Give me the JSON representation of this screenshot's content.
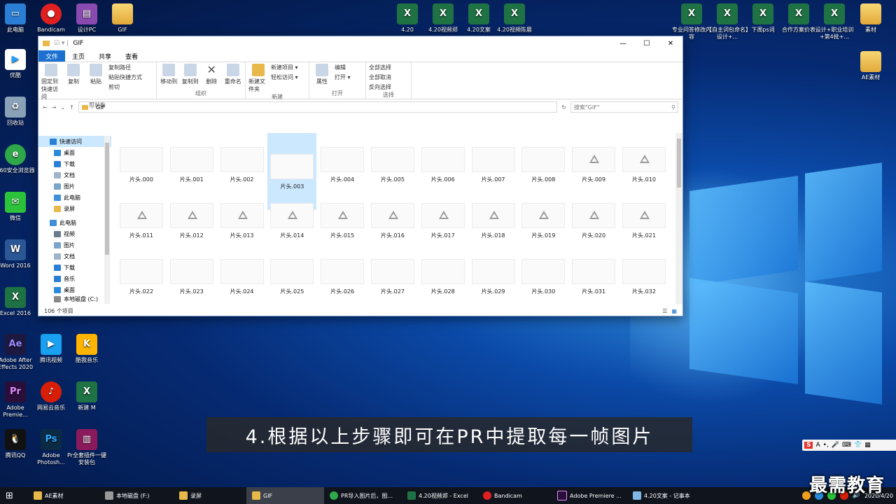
{
  "desktop_icons_left": [
    {
      "label": "此电脑",
      "icon": "computer-icon"
    },
    {
      "label": "Bandicam",
      "icon": "bandicam-icon"
    },
    {
      "label": "设计PC",
      "icon": "archive-icon"
    },
    {
      "label": "GIF",
      "icon": "folder-icon"
    },
    {
      "label": "优酷",
      "icon": "youku-icon"
    },
    {
      "label": "回收站",
      "icon": "recycle-bin-icon"
    },
    {
      "label": "360安全浏览器",
      "icon": "browser-icon"
    },
    {
      "label": "微信",
      "icon": "wechat-icon"
    },
    {
      "label": "Word 2016",
      "icon": "word-icon"
    },
    {
      "label": "Excel 2016",
      "icon": "excel-icon"
    },
    {
      "label": "Adobe After Effects 2020",
      "icon": "ae-icon"
    },
    {
      "label": "腾讯视频",
      "icon": "tencent-video-icon"
    },
    {
      "label": "酷我音乐",
      "icon": "kuwo-icon"
    },
    {
      "label": "Adobe Premie...",
      "icon": "premiere-icon"
    },
    {
      "label": "网易云音乐",
      "icon": "netease-music-icon"
    },
    {
      "label": "新建 M",
      "icon": "excel-icon"
    },
    {
      "label": "腾讯QQ",
      "icon": "qq-icon"
    },
    {
      "label": "Adobe Photosh...",
      "icon": "photoshop-icon"
    },
    {
      "label": "Pr全套插件一键安装包",
      "icon": "winrar-icon"
    }
  ],
  "desktop_icons_top": [
    "4.20",
    "4.20视频郑",
    "4.20文案",
    "4.20视频陈晨"
  ],
  "desktop_icons_right": [
    "专业问答修改内容",
    "【自主词包命名】设计+...",
    "下周ps词",
    "合作方案价表",
    "设计+职业培训+第4批+...",
    "素材",
    "AE素材"
  ],
  "window": {
    "title": "GIF",
    "tabs": [
      "文件",
      "主页",
      "共享",
      "查看"
    ],
    "ribbon": {
      "clipboard": {
        "pin": "固定到快速访问",
        "copy": "复制",
        "paste": "粘贴",
        "copy_path": "复制路径",
        "paste_shortcut": "粘贴快捷方式",
        "cut": "剪切",
        "label": "剪贴板"
      },
      "organize": {
        "move_to": "移动到",
        "copy_to": "复制到",
        "delete": "删除",
        "rename": "重命名",
        "label": "组织"
      },
      "new": {
        "new_folder": "新建文件夹",
        "new_item": "新建项目 ▾",
        "easy_access": "轻松访问 ▾",
        "label": "新建"
      },
      "open": {
        "properties": "属性",
        "open": "打开 ▾",
        "edit": "编辑",
        "label": "打开"
      },
      "select": {
        "select_all": "全部选择",
        "select_none": "全部取消",
        "invert": "反向选择",
        "label": "选择"
      }
    },
    "address": "GIF",
    "search_placeholder": "搜索\"GIF\"",
    "nav": {
      "quick_access": "快速访问",
      "quick_items": [
        "桌面",
        "下载",
        "文档",
        "图片",
        "此电脑",
        "录屏"
      ],
      "this_pc": "此电脑",
      "pc_items": [
        "视频",
        "图片",
        "文档",
        "下载",
        "音乐",
        "桌面",
        "本地磁盘 (C:)"
      ]
    },
    "files": [
      "片头.000",
      "片头.001",
      "片头.002",
      "片头.003",
      "片头.004",
      "片头.005",
      "片头.006",
      "片头.007",
      "片头.008",
      "片头.009",
      "片头.010",
      "片头.011",
      "片头.012",
      "片头.013",
      "片头.014",
      "片头.015",
      "片头.016",
      "片头.017",
      "片头.018",
      "片头.019",
      "片头.020",
      "片头.021",
      "片头.022",
      "片头.023",
      "片头.024",
      "片头.025",
      "片头.026",
      "片头.027",
      "片头.028",
      "片头.029",
      "片头.030",
      "片头.031",
      "片头.032"
    ],
    "status": "106 个项目"
  },
  "caption": "4.根据以上步骤即可在PR中提取每一帧图片",
  "taskbar": [
    {
      "label": "AE素材",
      "icon": "folder-icon"
    },
    {
      "label": "本地磁盘 (F:)",
      "icon": "drive-icon"
    },
    {
      "label": "录屏",
      "icon": "folder-icon"
    },
    {
      "label": "GIF",
      "icon": "folder-icon",
      "active": true
    },
    {
      "label": "PR导入图片后，图...",
      "icon": "browser-icon"
    },
    {
      "label": "4.20视频郑 - Excel",
      "icon": "excel-icon"
    },
    {
      "label": "Bandicam",
      "icon": "bandicam-icon"
    },
    {
      "label": "Adobe Premiere ...",
      "icon": "premiere-icon"
    },
    {
      "label": "4.20文案 - 记事本",
      "icon": "notepad-icon"
    }
  ],
  "clock_date": "2020/4/20",
  "brand": "最需教育",
  "ime_label": "S",
  "colors": {
    "accent": "#1a6fcf",
    "excel": "#1f7244",
    "folder": "#e8b84a"
  }
}
